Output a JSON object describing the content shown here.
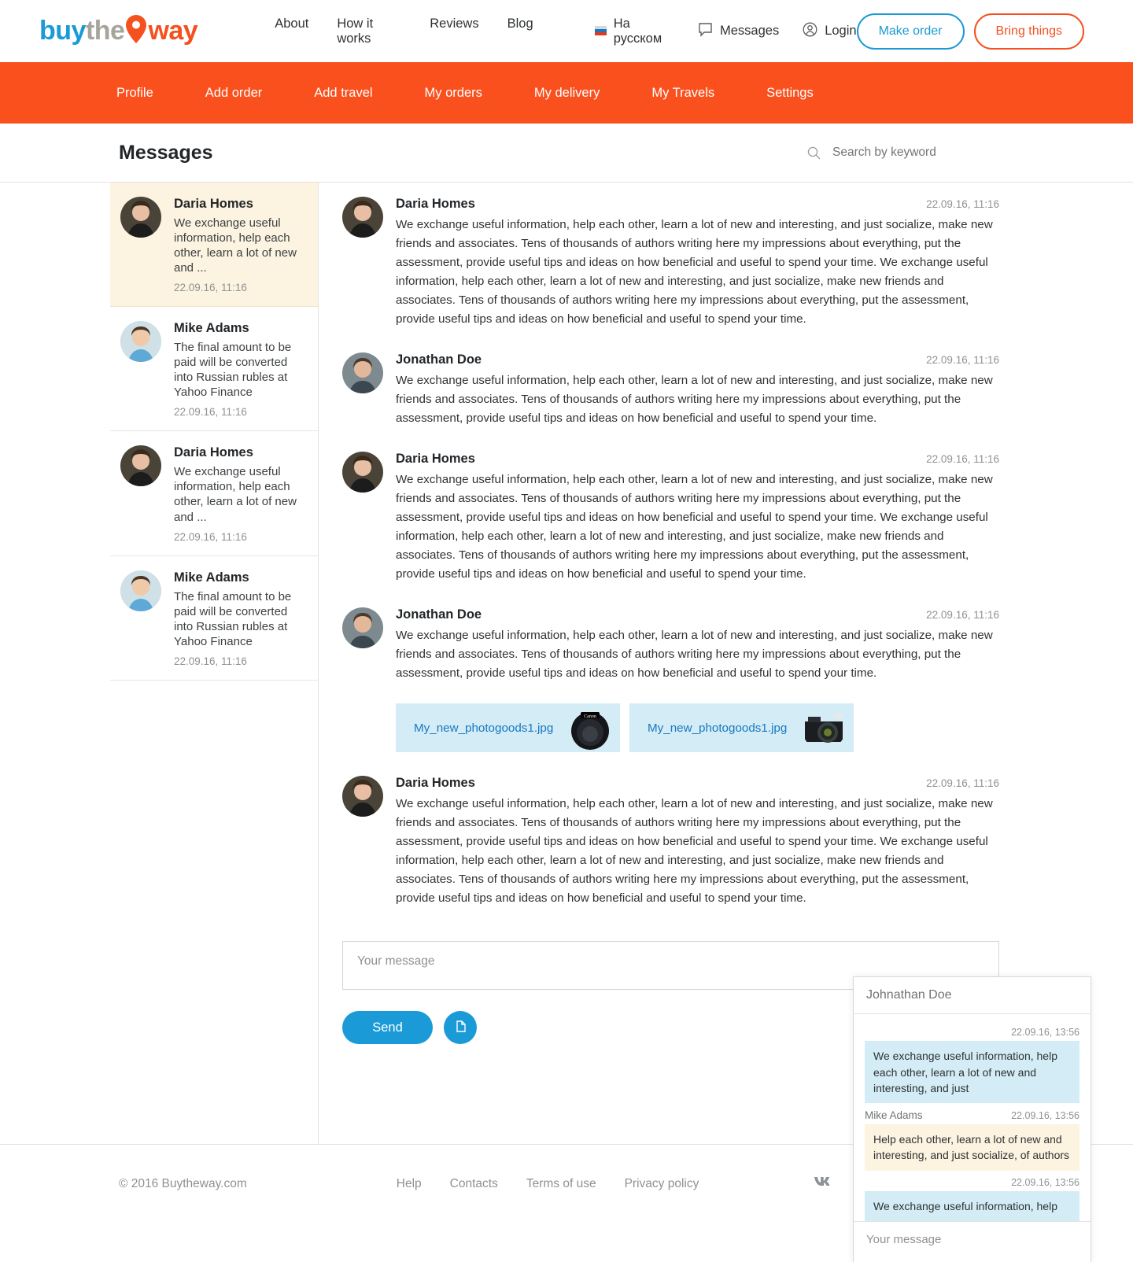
{
  "brand": {
    "logo_buy": "buy",
    "logo_the": "the",
    "logo_way": "way",
    "accent_orange": "#f9501e",
    "accent_blue": "#1a9ad6",
    "highlight_cream": "#fcf3e0",
    "bubble_blue": "#d3ecf5"
  },
  "header": {
    "nav": [
      {
        "label": "About"
      },
      {
        "label": "How it works"
      },
      {
        "label": "Reviews"
      },
      {
        "label": "Blog"
      }
    ],
    "language": "На русском",
    "messages": "Messages",
    "login": "Login",
    "make_order": "Make order",
    "bring_things": "Bring things"
  },
  "subnav": [
    {
      "label": "Profile"
    },
    {
      "label": "Add order"
    },
    {
      "label": "Add travel"
    },
    {
      "label": "My orders"
    },
    {
      "label": "My delivery"
    },
    {
      "label": "My Travels"
    },
    {
      "label": "Settings"
    }
  ],
  "page": {
    "title": "Messages",
    "search_placeholder": "Search by keyword"
  },
  "conversations": [
    {
      "name": "Daria Homes",
      "snippet": "We exchange useful information, help each other, learn a lot of new and ...",
      "time": "22.09.16, 11:16",
      "avatar": "woman",
      "active": true
    },
    {
      "name": "Mike Adams",
      "snippet": "The final amount to be paid will be converted into Russian rubles at Yahoo Finance",
      "time": "22.09.16, 11:16",
      "avatar": "man-blue",
      "active": false
    },
    {
      "name": "Daria Homes",
      "snippet": "We exchange useful information, help each other, learn a lot of new and ...",
      "time": "22.09.16, 11:16",
      "avatar": "woman",
      "active": false
    },
    {
      "name": "Mike Adams",
      "snippet": "The final amount to be paid will be converted into Russian rubles at Yahoo Finance",
      "time": "22.09.16, 11:16",
      "avatar": "man-blue",
      "active": false
    }
  ],
  "thread": [
    {
      "name": "Daria Homes",
      "time": "22.09.16, 11:16",
      "avatar": "woman",
      "text": "We exchange useful information, help each other, learn a lot of new and interesting, and just socialize, make new friends and associates. Tens of thousands of authors writing here my impressions about everything, put the assessment, provide useful tips and ideas on how beneficial and useful to spend your time. We exchange useful information, help each other, learn a lot of new and interesting, and just socialize, make new friends and associates. Tens of thousands of authors writing here my impressions about everything, put the assessment, provide useful tips and ideas on how beneficial and useful to spend your time."
    },
    {
      "name": "Jonathan Doe",
      "time": "22.09.16, 11:16",
      "avatar": "man-grey",
      "text": "We exchange useful information, help each other, learn a lot of new and interesting, and just socialize, make new friends and associates. Tens of thousands of authors writing here my impressions about everything, put the assessment, provide useful tips and ideas on how beneficial and useful to spend your time."
    },
    {
      "name": "Daria Homes",
      "time": "22.09.16, 11:16",
      "avatar": "woman",
      "text": "We exchange useful information, help each other, learn a lot of new and interesting, and just socialize, make new friends and associates. Tens of thousands of authors writing here my impressions about everything, put the assessment, provide useful tips and ideas on how beneficial and useful to spend your time. We exchange useful information, help each other, learn a lot of new and interesting, and just socialize, make new friends and associates. Tens of thousands of authors writing here my impressions about everything, put the assessment, provide useful tips and ideas on how beneficial and useful to spend your time."
    },
    {
      "name": "Jonathan Doe",
      "time": "22.09.16, 11:16",
      "avatar": "man-grey",
      "text": "We exchange useful information, help each other, learn a lot of new and interesting, and just socialize, make new friends and associates. Tens of thousands of authors writing here my impressions about everything, put the assessment, provide useful tips and ideas on how beneficial and useful to spend your time.",
      "attachments": [
        {
          "filename": "My_new_photogoods1.jpg",
          "thumb": "canon-lens"
        },
        {
          "filename": "My_new_photogoods1.jpg",
          "thumb": "canon-body"
        }
      ]
    },
    {
      "name": "Daria Homes",
      "time": "22.09.16, 11:16",
      "avatar": "woman",
      "text": "We exchange useful information, help each other, learn a lot of new and interesting, and just socialize, make new friends and associates. Tens of thousands of authors writing here my impressions about everything, put the assessment, provide useful tips and ideas on how beneficial and useful to spend your time. We exchange useful information, help each other, learn a lot of new and interesting, and just socialize, make new friends and associates. Tens of thousands of authors writing here my impressions about everything, put the assessment, provide useful tips and ideas on how beneficial and useful to spend your time."
    }
  ],
  "composer": {
    "placeholder": "Your message",
    "send_label": "Send"
  },
  "chat_widget": {
    "title": "Johnathan Doe",
    "messages": [
      {
        "sender": "",
        "time": "22.09.16, 13:56",
        "text": "We exchange useful information, help each other, learn a lot of new and interesting, and just",
        "side": "in"
      },
      {
        "sender": "Mike Adams",
        "time": "22.09.16, 13:56",
        "text": "Help each other, learn a lot of new and interesting, and just socialize, of authors",
        "side": "out"
      },
      {
        "sender": "",
        "time": "22.09.16, 13:56",
        "text": "We exchange useful information, help",
        "side": "in"
      }
    ],
    "input_placeholder": "Your message"
  },
  "footer": {
    "copyright": "© 2016 Buytheway.com",
    "links": [
      {
        "label": "Help"
      },
      {
        "label": "Contacts"
      },
      {
        "label": "Terms of use"
      },
      {
        "label": "Privacy policy"
      }
    ]
  }
}
